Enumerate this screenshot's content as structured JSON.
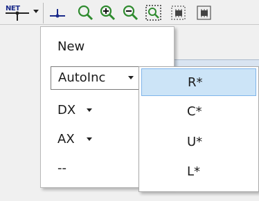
{
  "toolbar": {
    "net_label": "NET",
    "buttons": [
      {
        "name": "net-dropdown",
        "icon": "net-icon"
      },
      {
        "name": "junction-tool",
        "icon": "junction-icon"
      },
      {
        "name": "zoom",
        "icon": "magnifier-icon"
      },
      {
        "name": "zoom-in",
        "icon": "zoom-in-icon"
      },
      {
        "name": "zoom-out",
        "icon": "zoom-out-icon"
      },
      {
        "name": "zoom-area",
        "icon": "zoom-area-icon"
      },
      {
        "name": "component-view-1",
        "icon": "chip-icon"
      },
      {
        "name": "component-view-2",
        "icon": "chip-icon"
      }
    ]
  },
  "menu": {
    "items": [
      {
        "label": "New"
      },
      {
        "label": "AutoInc"
      },
      {
        "label": "DX"
      },
      {
        "label": "AX"
      },
      {
        "label": "--"
      }
    ]
  },
  "submenu": {
    "items": [
      {
        "label": "R*",
        "selected": true
      },
      {
        "label": "C*",
        "selected": false
      },
      {
        "label": "U*",
        "selected": false
      },
      {
        "label": "L*",
        "selected": false
      }
    ]
  },
  "colors": {
    "selection_fill": "#cce4f7",
    "selection_border": "#7eb4ea",
    "icon_green": "#2e8b2e",
    "net_label": "#1a2a8a"
  }
}
